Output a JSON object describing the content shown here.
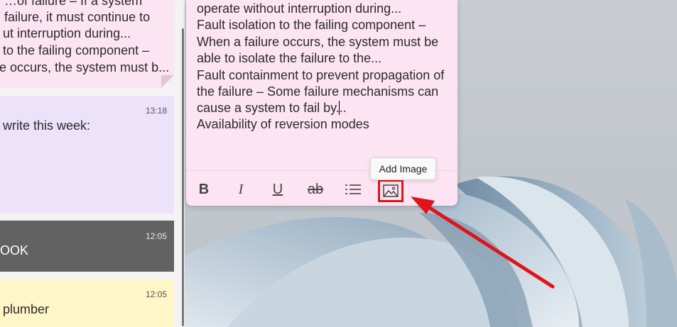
{
  "notes_list": {
    "items": [
      {
        "color": "#fde4f2",
        "time": "",
        "lines": [
          "…of failure – If a system",
          "failure, it must continue to",
          "ut interruption during...",
          "to the failing component –",
          "e occurs, the system must b..."
        ]
      },
      {
        "color": "#ece3fb",
        "time": "13:18",
        "body": "write this week:"
      },
      {
        "color": "#626262",
        "time": "12:05",
        "body": "OOK"
      },
      {
        "color": "#fff6c8",
        "time": "12:05",
        "body": "plumber"
      }
    ]
  },
  "editor": {
    "lines": [
      "operate without interruption during...",
      "Fault isolation to the failing component –",
      "When a failure occurs, the system must be",
      "able to isolate the failure to the...",
      "Fault containment to prevent propagation of",
      "the failure – Some failure mechanisms can",
      "cause a system to fail by...",
      "Availability of reversion modes"
    ]
  },
  "toolbar": {
    "bold": "B",
    "italic": "I",
    "underline": "U",
    "strikethrough": "ab",
    "list_icon": "bullet-list-icon",
    "image_icon": "image-icon"
  },
  "tooltip": {
    "text": "Add Image"
  },
  "colors": {
    "highlight": "#e0141a",
    "note_pink": "#fde4f2"
  }
}
